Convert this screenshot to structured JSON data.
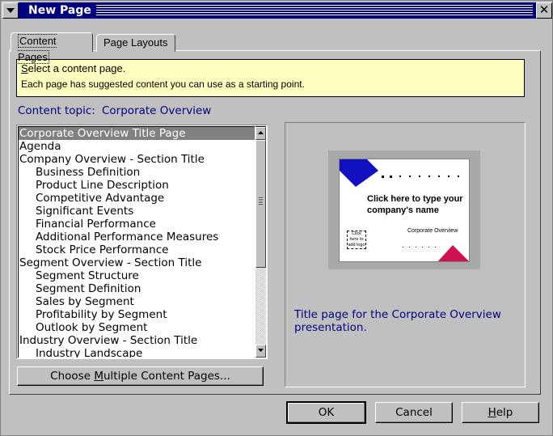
{
  "window": {
    "title": "New Page",
    "close_glyph": "✕"
  },
  "tabs": [
    {
      "label": "Content Pages",
      "active": true
    },
    {
      "label": "Page Layouts",
      "active": false
    }
  ],
  "hint": {
    "title_first": "S",
    "title_rest": "elect a content page.",
    "body": "Each page has suggested content you can use as a starting point."
  },
  "content_topic": {
    "label": "Content topic:",
    "value": "Corporate Overview"
  },
  "content_pages": [
    {
      "label": "Corporate Overview Title Page",
      "indent": false,
      "selected": true
    },
    {
      "label": "Agenda",
      "indent": false
    },
    {
      "label": "Company Overview - Section Title",
      "indent": false
    },
    {
      "label": "Business Definition",
      "indent": true
    },
    {
      "label": "Product Line Description",
      "indent": true
    },
    {
      "label": "Competitive Advantage",
      "indent": true
    },
    {
      "label": "Significant Events",
      "indent": true
    },
    {
      "label": "Financial Performance",
      "indent": true
    },
    {
      "label": "Additional Performance Measures",
      "indent": true
    },
    {
      "label": "Stock Price Performance",
      "indent": true
    },
    {
      "label": "Segment Overview - Section Title",
      "indent": false
    },
    {
      "label": "Segment Structure",
      "indent": true
    },
    {
      "label": "Segment Definition",
      "indent": true
    },
    {
      "label": "Sales by Segment",
      "indent": true
    },
    {
      "label": "Profitability by Segment",
      "indent": true
    },
    {
      "label": "Outlook by Segment",
      "indent": true
    },
    {
      "label": "Industry Overview - Section Title",
      "indent": false
    },
    {
      "label": "Industry Landscape",
      "indent": true
    }
  ],
  "choose_button": {
    "before": "Choose ",
    "mnemonic": "M",
    "after": "ultiple Content Pages..."
  },
  "preview": {
    "title_text": "Click here to type your company's name",
    "subtitle": "Corporate Overview",
    "address_text": "Click here to add logo",
    "description": "Title page for the Corporate Overview presentation.",
    "colors": {
      "triangle_top": "#1010c0",
      "triangle_bottom": "#d01050"
    }
  },
  "buttons": {
    "ok": "OK",
    "cancel": "Cancel",
    "help_mnemonic": "H",
    "help_rest": "elp"
  }
}
